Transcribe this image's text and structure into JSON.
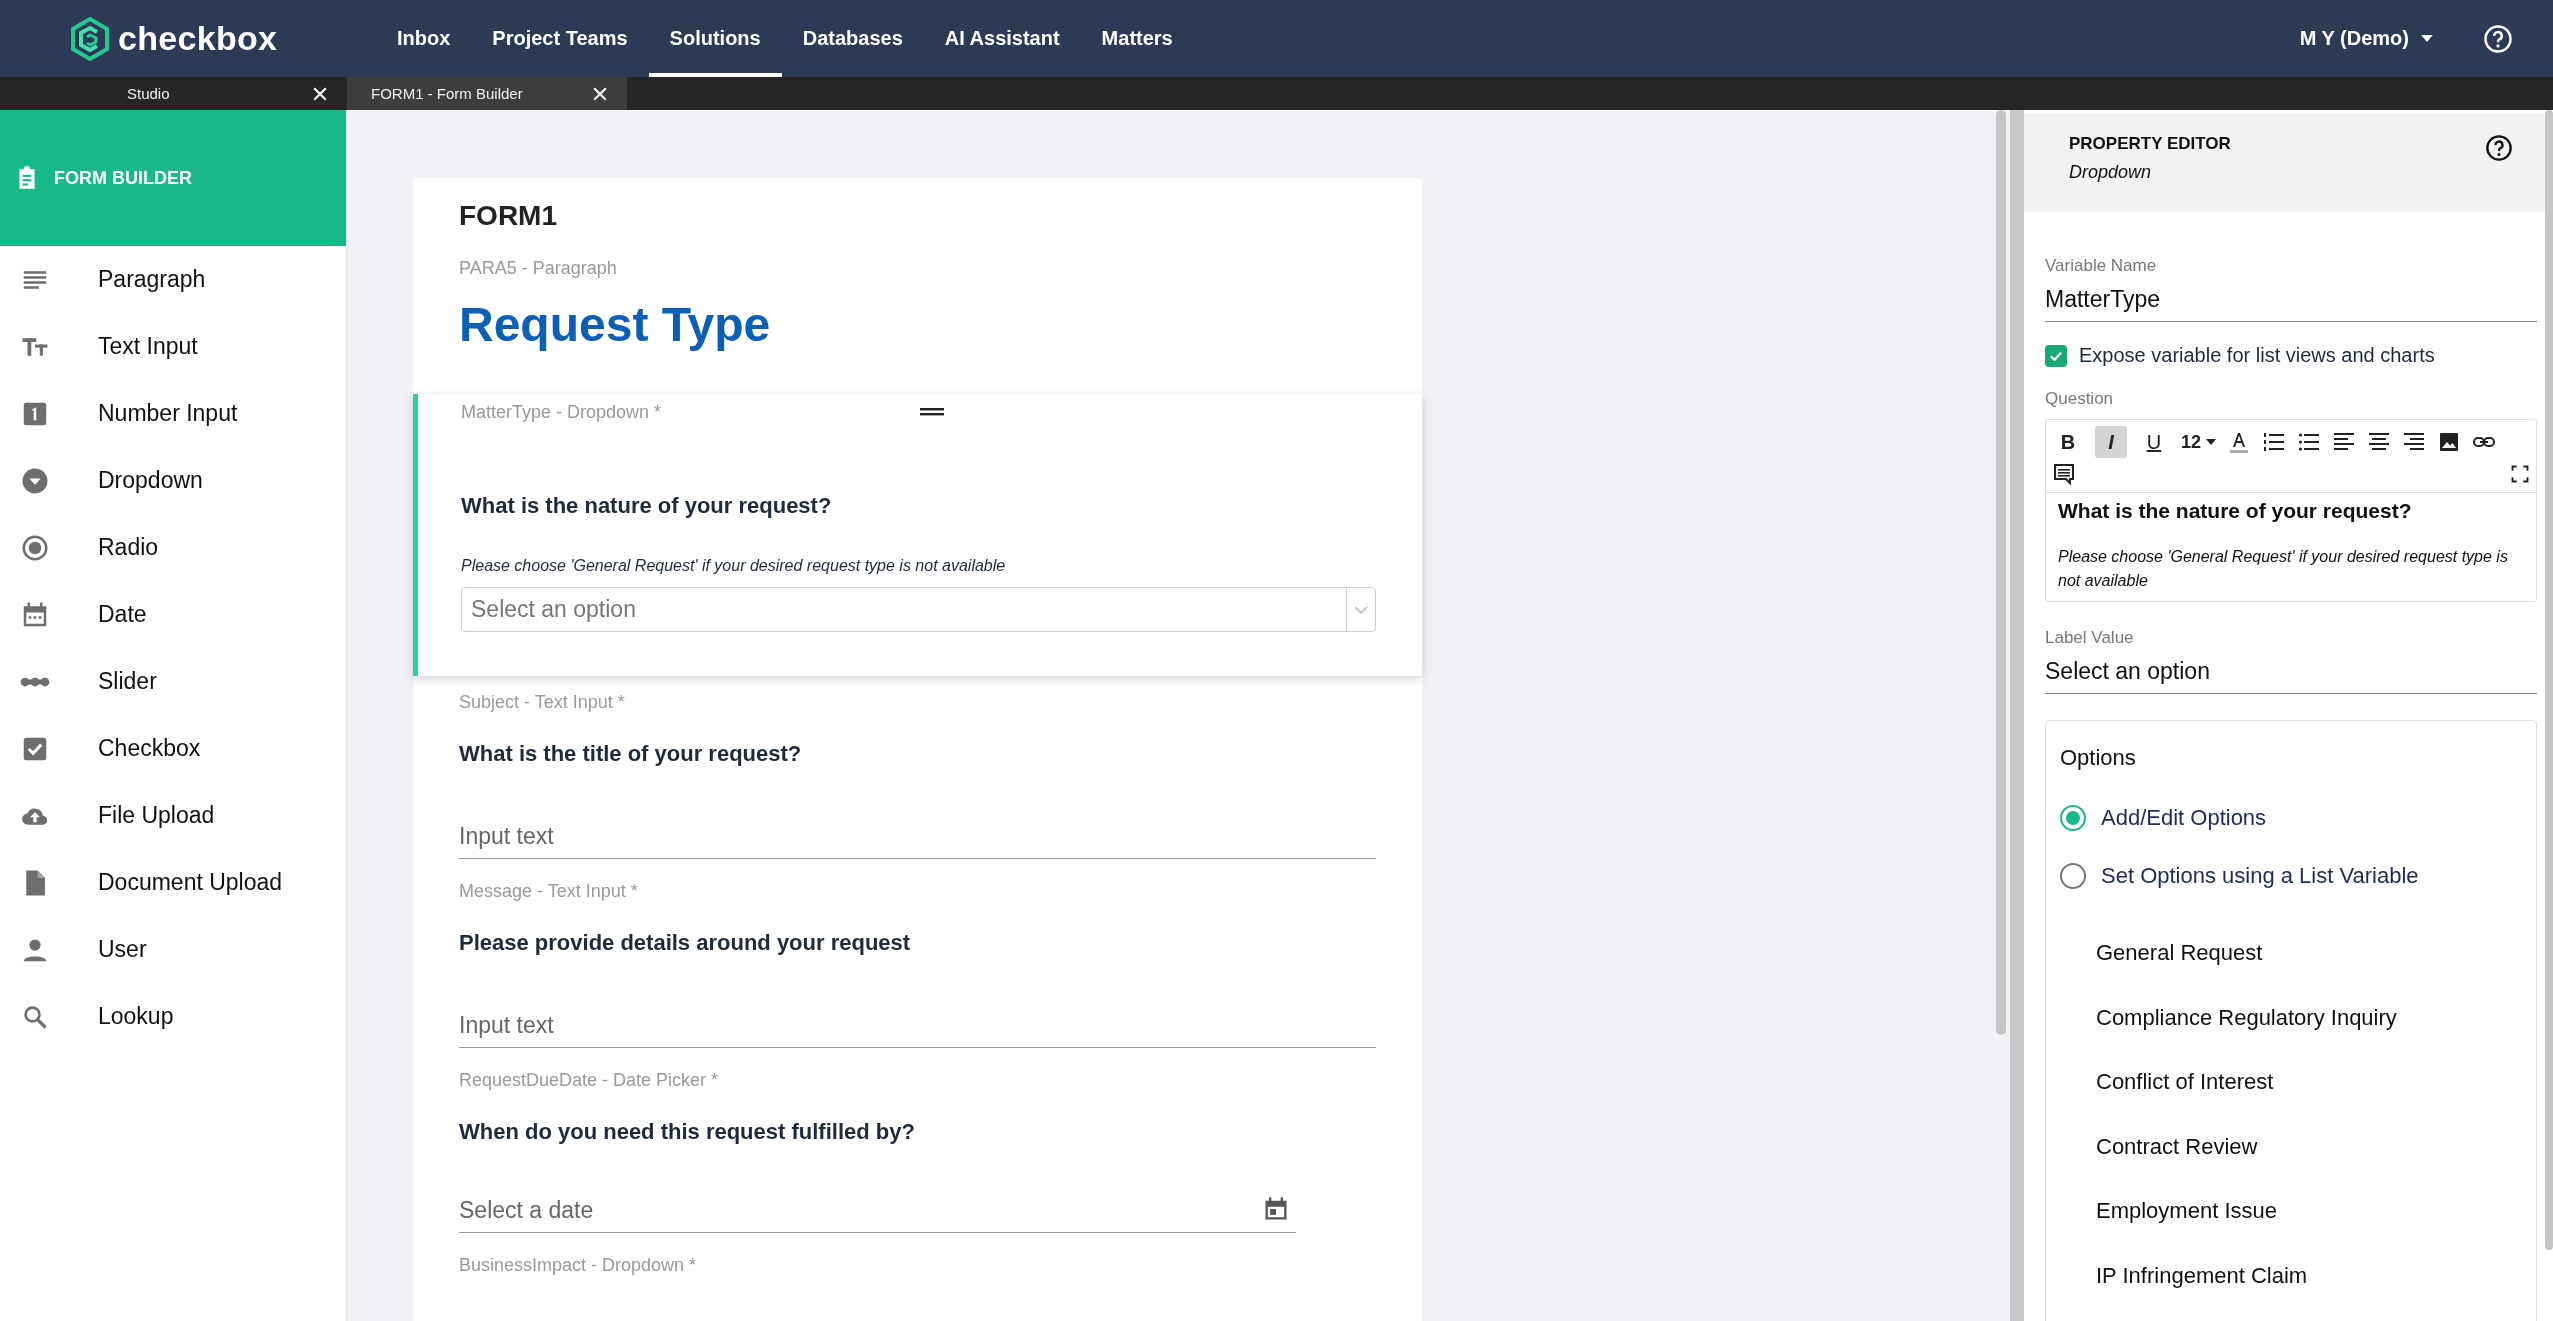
{
  "top_nav": {
    "logo": "checkbox",
    "items": [
      {
        "label": "Inbox",
        "selected": false
      },
      {
        "label": "Project Teams",
        "selected": false
      },
      {
        "label": "Solutions",
        "selected": true
      },
      {
        "label": "Databases",
        "selected": false
      },
      {
        "label": "AI Assistant",
        "selected": false
      },
      {
        "label": "Matters",
        "selected": false
      }
    ],
    "user": "M Y (Demo)"
  },
  "tabs": [
    {
      "label": "Studio",
      "selected": false
    },
    {
      "label": "FORM1 - Form Builder",
      "selected": true
    }
  ],
  "sidebar": {
    "title": "FORM BUILDER",
    "items": [
      {
        "kind": "paragraph",
        "label": "Paragraph"
      },
      {
        "kind": "text",
        "label": "Text Input"
      },
      {
        "kind": "number",
        "label": "Number Input"
      },
      {
        "kind": "dropdown",
        "label": "Dropdown"
      },
      {
        "kind": "radio",
        "label": "Radio"
      },
      {
        "kind": "date",
        "label": "Date"
      },
      {
        "kind": "slider",
        "label": "Slider"
      },
      {
        "kind": "checkbox",
        "label": "Checkbox"
      },
      {
        "kind": "file",
        "label": "File Upload"
      },
      {
        "kind": "document",
        "label": "Document Upload"
      },
      {
        "kind": "user",
        "label": "User"
      },
      {
        "kind": "lookup",
        "label": "Lookup"
      }
    ]
  },
  "form": {
    "title": "FORM1",
    "fields": [
      {
        "kind": "paragraph",
        "meta": "PARA5 - Paragraph",
        "text": "Request Type",
        "selected": false
      },
      {
        "kind": "dropdown",
        "meta": "MatterType - Dropdown *",
        "question": "What is the nature of your request?",
        "hint": "Please choose 'General Request' if your desired request type is not available",
        "placeholder": "Select an option",
        "selected": true
      },
      {
        "kind": "text",
        "meta": "Subject - Text Input *",
        "question": "What is the title of your request?",
        "placeholder": "Input text",
        "selected": false
      },
      {
        "kind": "text",
        "meta": "Message - Text Input *",
        "question": "Please provide details around your request",
        "placeholder": "Input text",
        "selected": false
      },
      {
        "kind": "date",
        "meta": "RequestDueDate - Date Picker *",
        "question": "When do you need this request fulfilled by?",
        "placeholder": "Select a date",
        "selected": false
      },
      {
        "kind": "dropdown",
        "meta": "BusinessImpact - Dropdown *",
        "selected": false
      }
    ]
  },
  "property_editor": {
    "title": "PROPERTY EDITOR",
    "subtitle": "Dropdown",
    "variable_name": {
      "label": "Variable Name",
      "value": "MatterType"
    },
    "expose": {
      "label": "Expose variable for list views and charts",
      "checked": true
    },
    "question": {
      "label": "Question",
      "format_buttons": [
        {
          "kind": "bold",
          "label": "B",
          "active": false
        },
        {
          "kind": "italic",
          "label": "I",
          "active": true
        },
        {
          "kind": "underline",
          "label": "U",
          "active": false
        }
      ],
      "font_size": "12",
      "text": "What is the nature of your request?",
      "hint": "Please choose 'General Request' if your desired request type is not available"
    },
    "label_value": {
      "label": "Label Value",
      "value": "Select an option"
    },
    "options": {
      "title": "Options",
      "modes": [
        {
          "label": "Add/Edit Options",
          "selected": true
        },
        {
          "label": "Set Options using a List Variable",
          "selected": false
        }
      ],
      "items": [
        "General Request",
        "Compliance Regulatory Inquiry",
        "Conflict of Interest",
        "Contract Review",
        "Employment Issue",
        "IP Infringement Claim"
      ]
    }
  }
}
